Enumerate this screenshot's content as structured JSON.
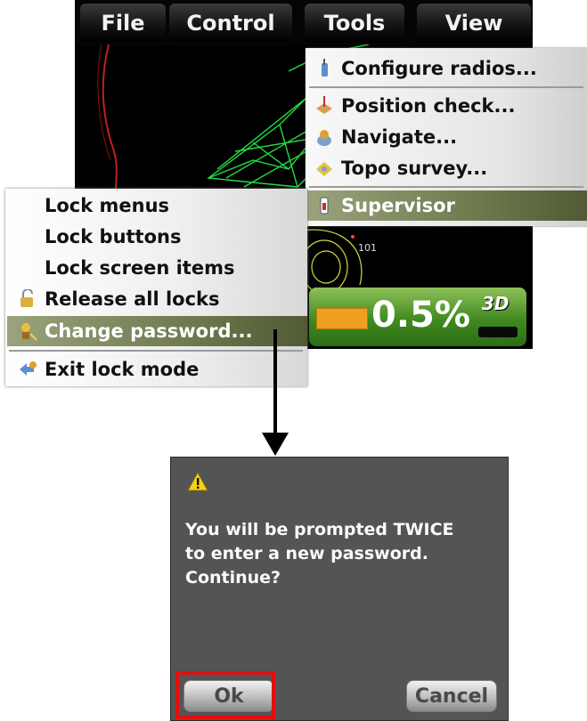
{
  "menubar": {
    "items": [
      "File",
      "Control",
      "Tools",
      "View"
    ]
  },
  "tools_menu": {
    "items": [
      {
        "label": "Configure radios...",
        "icon": "radio-icon"
      },
      {
        "label": "Position check...",
        "icon": "position-check-icon"
      },
      {
        "label": "Navigate...",
        "icon": "navigate-icon"
      },
      {
        "label": "Topo survey...",
        "icon": "topo-survey-icon"
      },
      {
        "label": "Supervisor",
        "icon": "supervisor-icon",
        "selected": true
      }
    ]
  },
  "lock_menu": {
    "items": [
      {
        "label": "Lock menus"
      },
      {
        "label": "Lock buttons"
      },
      {
        "label": "Lock screen items"
      },
      {
        "label": "Release all locks",
        "icon": "release-locks-icon"
      },
      {
        "label": "Change password...",
        "icon": "change-password-icon",
        "selected": true
      },
      {
        "label": "Exit lock mode",
        "icon": "exit-lock-mode-icon"
      }
    ]
  },
  "map": {
    "label": "101"
  },
  "status": {
    "progress_text": "0.5%",
    "progress_value": 0.005,
    "badge": "3D"
  },
  "dialog": {
    "icon": "warning-icon",
    "message": "You will be prompted TWICE\nto enter a new password.\nContinue?",
    "ok_label": "Ok",
    "cancel_label": "Cancel"
  },
  "colors": {
    "selected_item": "#6f7a4e",
    "dialog_bg": "#545454",
    "highlight": "#e01010",
    "progress_fill": "#f0a020"
  }
}
